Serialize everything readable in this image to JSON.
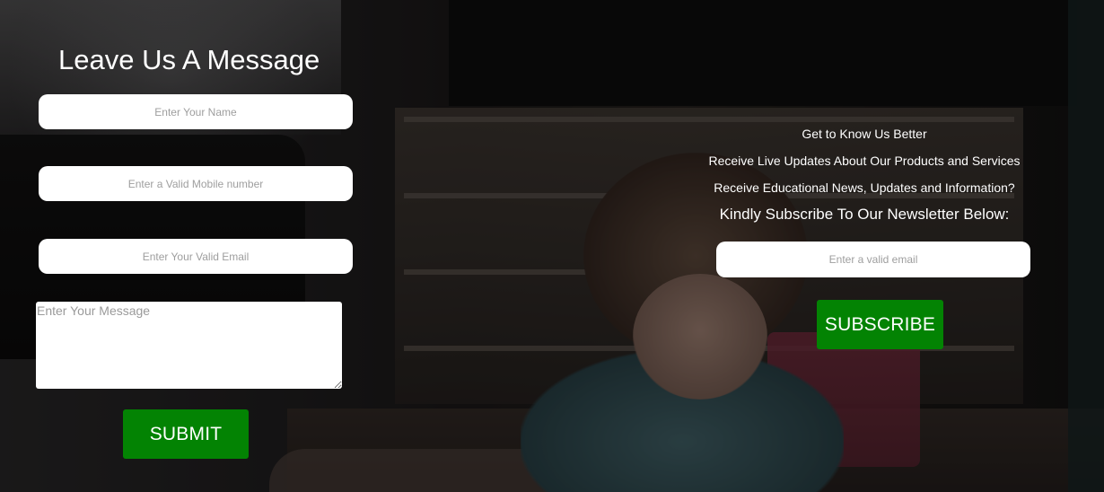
{
  "message_form": {
    "title": "Leave Us A Message",
    "name_placeholder": "Enter Your Name",
    "mobile_placeholder": "Enter a Valid Mobile number",
    "email_placeholder": "Enter Your Valid Email",
    "message_placeholder": "Enter Your Message",
    "submit_label": "SUBMIT"
  },
  "newsletter": {
    "lines": [
      "Get to Know Us Better",
      "Receive Live Updates About Our Products and Services",
      "Receive Educational News, Updates and Information?"
    ],
    "heading": "Kindly Subscribe To Our Newsletter Below:",
    "email_placeholder": "Enter a valid email",
    "subscribe_label": "SUBSCRIBE"
  },
  "colors": {
    "button_green": "#038303",
    "text_white": "#ffffff",
    "field_background": "#ffffff",
    "placeholder_gray": "#9e9e9e"
  },
  "background": {
    "image": "dark-photo-child-playing-indoors"
  }
}
